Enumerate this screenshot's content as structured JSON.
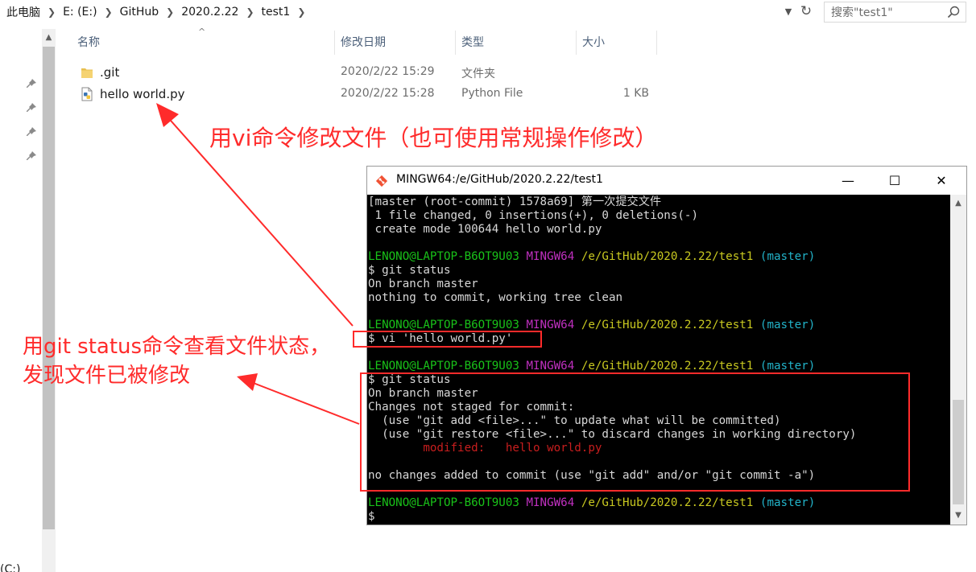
{
  "address": {
    "crumbs": [
      "此电脑",
      "E: (E:)",
      "GitHub",
      "2020.2.22",
      "test1"
    ],
    "dropdown_icon": "chevron-down-icon",
    "refresh_icon": "refresh-icon"
  },
  "search": {
    "placeholder": "搜索\"test1\""
  },
  "nav": {
    "drive_label": "(C:)"
  },
  "columns": {
    "name": "名称",
    "date": "修改日期",
    "type": "类型",
    "size": "大小"
  },
  "files": [
    {
      "name": ".git",
      "date": "2020/2/22 15:29",
      "type": "文件夹",
      "size": "",
      "icon": "folder-icon"
    },
    {
      "name": "hello world.py",
      "date": "2020/2/22 15:28",
      "type": "Python File",
      "size": "1 KB",
      "icon": "python-file-icon"
    }
  ],
  "annotations": {
    "vi_note": "用vi命令修改文件（也可使用常规操作修改）",
    "status_note_line1": "用git status命令查看文件状态，",
    "status_note_line2": "发现文件已被修改",
    "color": "#ff2b2b"
  },
  "terminal": {
    "title": "MINGW64:/e/GitHub/2020.2.22/test1",
    "buttons": {
      "minimize": "—",
      "maximize": "☐",
      "close": "✕"
    },
    "prompt": {
      "user": "LENONO@LAPTOP-B6OT9U03",
      "env": "MINGW64",
      "path": "/e/GitHub/2020.2.22/test1",
      "branch": "(master)"
    },
    "lines": {
      "l1": "[master (root-commit) 1578a69] 第一次提交文件",
      "l2": " 1 file changed, 0 insertions(+), 0 deletions(-)",
      "l3": " create mode 100644 hello world.py",
      "cmd1": "$ git status",
      "l5": "On branch master",
      "l6": "nothing to commit, working tree clean",
      "cmd2": "$ vi 'hello world.py'",
      "cmd3": "$ git status",
      "l9": "On branch master",
      "l10": "Changes not staged for commit:",
      "l11": "  (use \"git add <file>...\" to update what will be committed)",
      "l12": "  (use \"git restore <file>...\" to discard changes in working directory)",
      "l13": "        modified:   hello world.py",
      "l14": "no changes added to commit (use \"git add\" and/or \"git commit -a\")",
      "cmd4": "$"
    },
    "colors": {
      "user": "#19c219",
      "env": "#c030c0",
      "path": "#c8c820",
      "branch": "#22b3c9",
      "modified": "#c81e1e"
    }
  }
}
